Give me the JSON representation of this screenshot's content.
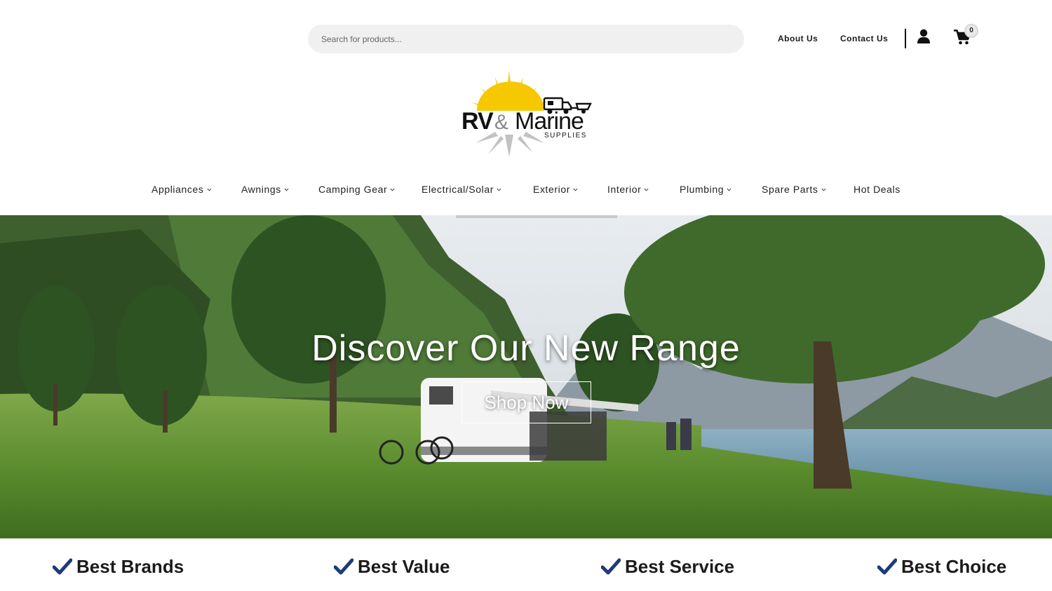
{
  "header": {
    "search": {
      "placeholder": "Search for products..."
    },
    "links": [
      {
        "label": "About Us"
      },
      {
        "label": "Contact Us"
      }
    ],
    "cart_count": "0",
    "icons": {
      "account": "user-icon",
      "cart": "shopping-cart-icon"
    }
  },
  "logo": {
    "text_main": "RV&Marine",
    "text_sub": "SUPPLIES"
  },
  "nav": {
    "items": [
      {
        "label": "Appliances",
        "dropdown": true
      },
      {
        "label": "Awnings",
        "dropdown": true
      },
      {
        "label": "Camping Gear",
        "dropdown": true
      },
      {
        "label": "Electrical/Solar",
        "dropdown": true
      },
      {
        "label": "Exterior",
        "dropdown": true
      },
      {
        "label": "Interior",
        "dropdown": true
      },
      {
        "label": "Plumbing",
        "dropdown": true
      },
      {
        "label": "Spare Parts",
        "dropdown": true
      },
      {
        "label": "Hot Deals",
        "dropdown": false
      }
    ]
  },
  "hero": {
    "title": "Discover Our New Range",
    "button_label": "Shop Now"
  },
  "benefits": [
    {
      "label": "Best Brands"
    },
    {
      "label": "Best Value"
    },
    {
      "label": "Best Service"
    },
    {
      "label": "Best Choice"
    }
  ],
  "colors": {
    "accent_check": "#1f3a7a",
    "search_bg": "#f0f0f0",
    "logo_sun": "#f5c800"
  }
}
